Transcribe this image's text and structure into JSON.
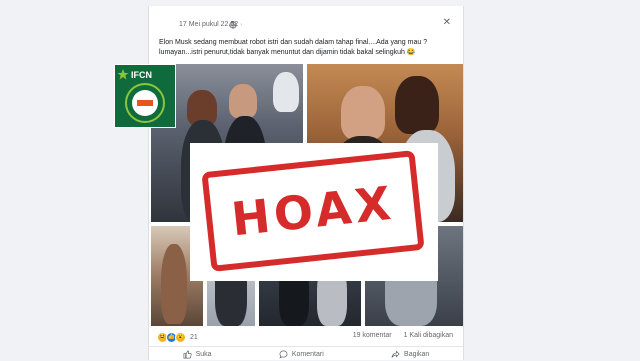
{
  "post": {
    "timestamp": "17 Mei pukul 22.52 ·",
    "caption_line1": "Elon Musk sedang membuat robot istri dan sudah dalam tahap final....Ada yang mau ?",
    "caption_line2": "lumayan...istri penurut,tidak banyak menuntut dan dijamin tidak bakal selingkuh 😂"
  },
  "overlay": {
    "stamp_text": "HOAX",
    "stamp_color": "#d62b2b"
  },
  "stats": {
    "reaction_count": "21",
    "comments": "19 komentar",
    "shares": "1 Kali dibagikan"
  },
  "actions": {
    "like": "Suka",
    "comment": "Komentari",
    "share": "Bagikan"
  },
  "colors": {
    "background": "#f0f2f5",
    "text_secondary": "#65676b",
    "badge_green": "#0f6b3b"
  },
  "icons": {
    "close": "close-icon",
    "globe": "globe-icon",
    "like": "thumbs-up-icon",
    "comment": "comment-icon",
    "share": "share-icon"
  }
}
